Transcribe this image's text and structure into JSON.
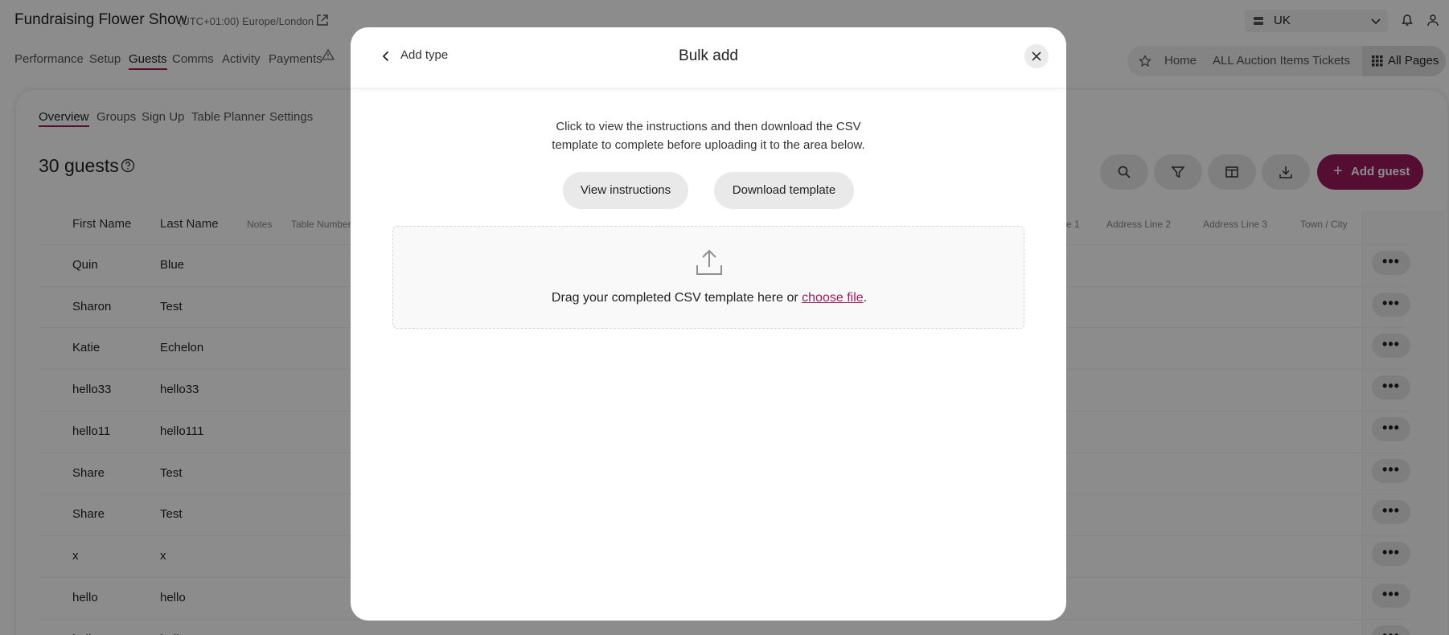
{
  "header": {
    "event_title": "Fundraising Flower Show",
    "timezone": "(UTC+01:00) Europe/London",
    "region": "UK"
  },
  "main_nav": {
    "tabs": [
      {
        "label": "Performance"
      },
      {
        "label": "Setup"
      },
      {
        "label": "Guests"
      },
      {
        "label": "Comms"
      },
      {
        "label": "Activity"
      },
      {
        "label": "Payments"
      }
    ],
    "active": "Guests"
  },
  "quick_links": {
    "items": [
      {
        "label": "Home"
      },
      {
        "label": "ALL Auction Items"
      },
      {
        "label": "Tickets"
      }
    ],
    "all_pages_label": "All Pages"
  },
  "sub_nav": {
    "tabs": [
      {
        "label": "Overview"
      },
      {
        "label": "Groups"
      },
      {
        "label": "Sign Up"
      },
      {
        "label": "Table Planner"
      },
      {
        "label": "Settings"
      }
    ],
    "active": "Overview"
  },
  "guests": {
    "count_label": "30 guests",
    "add_button_label": "Add guest",
    "columns": {
      "first_name": "First Name",
      "last_name": "Last Name",
      "notes": "Notes",
      "table_number": "Table Number",
      "address_line_1": "e 1",
      "address_line_2": "Address Line 2",
      "address_line_3": "Address Line 3",
      "town_city": "Town / City"
    },
    "rows": [
      {
        "first": "Quin",
        "last": "Blue"
      },
      {
        "first": "Sharon",
        "last": "Test"
      },
      {
        "first": "Katie",
        "last": "Echelon"
      },
      {
        "first": "hello33",
        "last": "hello33"
      },
      {
        "first": "hello11",
        "last": "hello111"
      },
      {
        "first": "Share",
        "last": "Test"
      },
      {
        "first": "Share",
        "last": "Test"
      },
      {
        "first": "x",
        "last": "x"
      },
      {
        "first": "hello",
        "last": "hello"
      },
      {
        "first": "hello",
        "last": "hello"
      }
    ]
  },
  "modal": {
    "back_label": "Add type",
    "title": "Bulk add",
    "instructions_line1": "Click to view the instructions and then download the CSV",
    "instructions_line2": "template to complete before uploading it to the area below.",
    "view_instructions_label": "View instructions",
    "download_template_label": "Download template",
    "dropzone_text": "Drag your completed CSV template here or ",
    "dropzone_link": "choose file",
    "dropzone_suffix": "."
  },
  "colors": {
    "accent": "#9b1b5a",
    "overlay": "rgba(0,0,0,0.45)"
  }
}
